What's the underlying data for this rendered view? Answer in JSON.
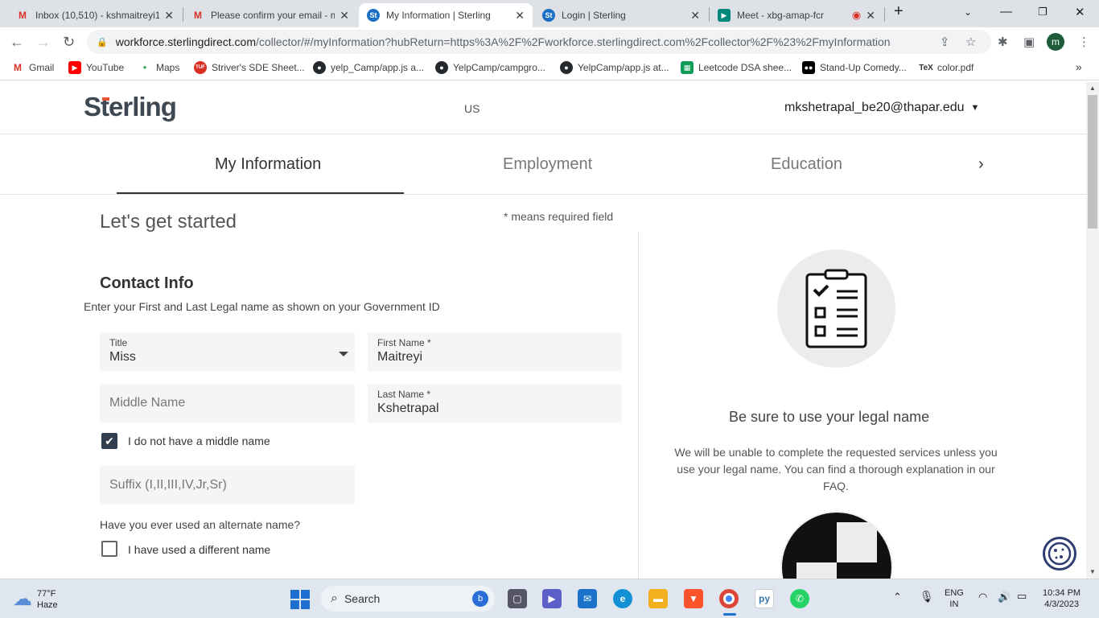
{
  "browser": {
    "tabs": [
      {
        "title": "Inbox (10,510) - kshmaitreyi1",
        "favicon": "gmail-icon",
        "active": false
      },
      {
        "title": "Please confirm your email - m",
        "favicon": "gmail-icon",
        "active": false
      },
      {
        "title": "My Information | Sterling",
        "favicon": "sterling-icon",
        "active": true
      },
      {
        "title": "Login | Sterling",
        "favicon": "sterling-icon",
        "active": false
      },
      {
        "title": "Meet - xbg-amap-fcr",
        "favicon": "meet-icon",
        "active": false
      }
    ],
    "url_host": "workforce.sterlingdirect.com",
    "url_rest": "/collector/#/myInformation?hubReturn=https%3A%2F%2Fworkforce.sterlingdirect.com%2Fcollector%2F%23%2FmyInformation",
    "profile_initial": "m",
    "bookmarks": [
      {
        "label": "Gmail",
        "icon": "gmail-icon"
      },
      {
        "label": "YouTube",
        "icon": "youtube-icon"
      },
      {
        "label": "Maps",
        "icon": "maps-icon"
      },
      {
        "label": "Striver's SDE Sheet...",
        "icon": "tuf-icon"
      },
      {
        "label": "yelp_Camp/app.js a...",
        "icon": "github-icon"
      },
      {
        "label": "YelpCamp/campgro...",
        "icon": "github-icon"
      },
      {
        "label": "YelpCamp/app.js at...",
        "icon": "github-icon"
      },
      {
        "label": "Leetcode DSA shee...",
        "icon": "sheets-icon"
      },
      {
        "label": "Stand-Up Comedy...",
        "icon": "medium-icon"
      },
      {
        "label": "color.pdf",
        "icon": "tex-icon"
      }
    ]
  },
  "header": {
    "logo": "Sterling",
    "region": "US",
    "user_email": "mkshetrapal_be20@thapar.edu"
  },
  "nav": {
    "tabs": [
      "My Information",
      "Employment",
      "Education"
    ]
  },
  "form": {
    "heading": "Let's get started",
    "required_note": "* means required field",
    "section_title": "Contact Info",
    "section_subtext": "Enter your First and Last Legal name as shown on your Government ID",
    "title_label": "Title",
    "title_value": "Miss",
    "first_name_label": "First Name *",
    "first_name_value": "Maitreyi",
    "middle_name_placeholder": "Middle Name",
    "last_name_label": "Last Name *",
    "last_name_value": "Kshetrapal",
    "no_middle_name_label": "I do not have a middle name",
    "no_middle_name_checked": true,
    "suffix_placeholder": "Suffix (I,II,III,IV,Jr,Sr)",
    "alternate_question": "Have you ever used an alternate name?",
    "different_name_label": "I have used a different name",
    "different_name_checked": false
  },
  "side": {
    "heading": "Be sure to use your legal name",
    "text": "We will be unable to complete the requested services unless you use your legal name. You can find a thorough explanation in our FAQ."
  },
  "taskbar": {
    "temperature": "77°F",
    "weather": "Haze",
    "search_label": "Search",
    "lang": "ENG",
    "region": "IN",
    "time": "10:34 PM",
    "date": "4/3/2023"
  },
  "colors": {
    "accent": "#2f3d4e",
    "logo_dot": "#e8542f",
    "field_bg": "#f5f5f5"
  }
}
